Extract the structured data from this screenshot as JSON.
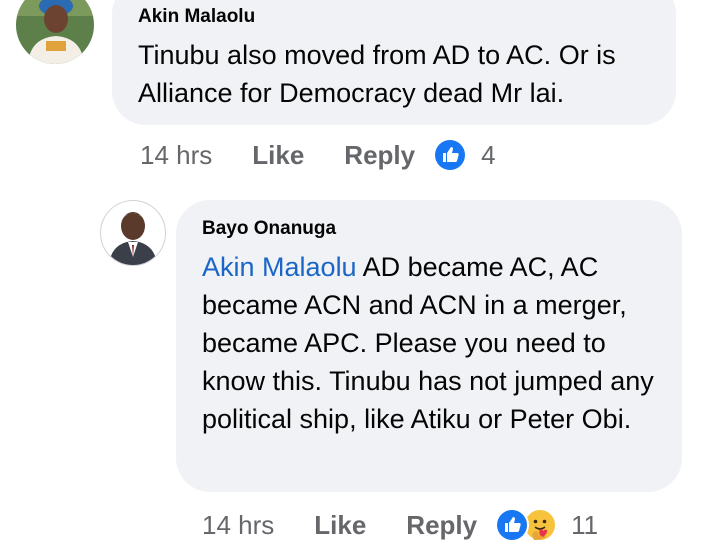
{
  "comments": [
    {
      "author": "Akin Malaolu",
      "text": "Tinubu also moved from AD to AC. Or is Alliance for Democracy dead Mr lai.",
      "time": "14 hrs",
      "like_label": "Like",
      "reply_label": "Reply",
      "reactions": [
        "like"
      ],
      "reaction_count": "4"
    },
    {
      "author": "Bayo Onanuga",
      "mention": "Akin Malaolu",
      "text": " AD became AC, AC became ACN and ACN in a merger, became APC. Please you need to know this. Tinubu has not jumped any political ship, like Atiku or Peter Obi.",
      "time": "14 hrs",
      "like_label": "Like",
      "reply_label": "Reply",
      "reactions": [
        "like",
        "care"
      ],
      "reaction_count": "11"
    }
  ],
  "colors": {
    "bubble_bg": "#f0f2f5",
    "mention": "#1a66c8",
    "meta": "#65676b",
    "like_blue": "#1877f2"
  }
}
